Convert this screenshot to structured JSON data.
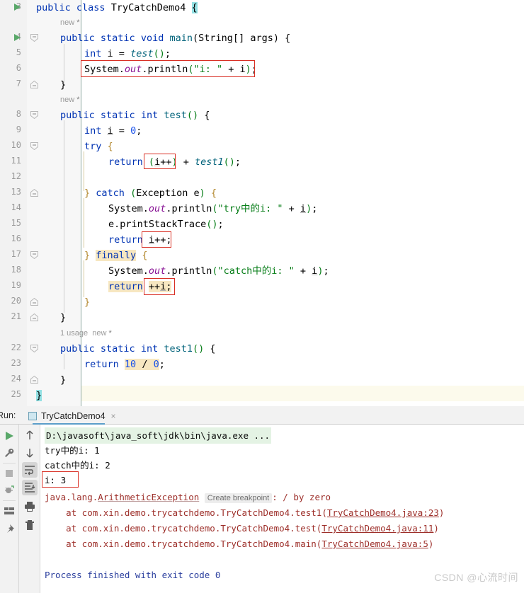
{
  "window": {
    "file_name": "TryCatchDemo4.java",
    "class_name": "TryCatchDemo4"
  },
  "editor": {
    "first_visible_line": 3,
    "lines": [
      {
        "n": "3",
        "text": "public class TryCatchDemo4 {"
      },
      {
        "n": "",
        "text": "new *"
      },
      {
        "n": "4",
        "text": "    public static void main(String[] args) {"
      },
      {
        "n": "5",
        "text": "        int i = test();"
      },
      {
        "n": "6",
        "text": "        System.out.println(\"i: \" + i);"
      },
      {
        "n": "7",
        "text": "    }"
      },
      {
        "n": "",
        "text": "new *"
      },
      {
        "n": "8",
        "text": "    public static int test() {"
      },
      {
        "n": "9",
        "text": "        int i = 0;"
      },
      {
        "n": "10",
        "text": "        try {"
      },
      {
        "n": "11",
        "text": "            return (i++) + test1();"
      },
      {
        "n": "12",
        "text": ""
      },
      {
        "n": "13",
        "text": "        } catch (Exception e) {"
      },
      {
        "n": "14",
        "text": "            System.out.println(\"try中的i: \" + i);"
      },
      {
        "n": "15",
        "text": "            e.printStackTrace();"
      },
      {
        "n": "16",
        "text": "            return i++;"
      },
      {
        "n": "17",
        "text": "        } finally {"
      },
      {
        "n": "18",
        "text": "            System.out.println(\"catch中的i: \" + i);"
      },
      {
        "n": "19",
        "text": "            return ++i;"
      },
      {
        "n": "20",
        "text": "        }"
      },
      {
        "n": "21",
        "text": "    }"
      },
      {
        "n": "",
        "text": "1 usage  new *"
      },
      {
        "n": "22",
        "text": "    public static int test1() {"
      },
      {
        "n": "23",
        "text": "        return 10 / 0;"
      },
      {
        "n": "24",
        "text": "    }"
      },
      {
        "n": "25",
        "text": "}"
      }
    ],
    "annotations": {
      "new_marker": "new",
      "new_star": "*",
      "usage_count": "1 usage"
    },
    "tokens": {
      "l3_public": "public",
      "l3_class": "class",
      "l3_name": "TryCatchDemo4",
      "l3_brace": "{",
      "l4": "public static void main(String[] args) {",
      "l4_public": "public",
      "l4_static": "static",
      "l4_void": "void",
      "l4_main": "main",
      "l4_string": "String",
      "l4_args": "args",
      "l5_int": "int",
      "l5_i": "i",
      "l5_test": "test",
      "l6_system": "System",
      "l6_out": "out",
      "l6_println": "println",
      "l6_str": "\"i: \"",
      "l6_i": "i",
      "l8_test": "test",
      "l8_int": "int",
      "l9_zero": "0",
      "l10_try": "try",
      "l11_return": "return",
      "l11_expr": "(i++)",
      "l11_test1": "test1",
      "l13_catch": "catch",
      "l13_exception": "Exception",
      "l13_e": "e",
      "l14_str": "\"try中的i: \"",
      "l15_e": "e",
      "l15_pst": "printStackTrace",
      "l16_return": "return",
      "l16_expr": "i++;",
      "l17_finally": "finally",
      "l18_str": "\"catch中的i: \"",
      "l19_return": "return",
      "l19_expr": "++i;",
      "l22_test1": "test1",
      "l23_return": "return",
      "l23_ten": "10",
      "l23_slash": "/",
      "l23_zero": "0"
    }
  },
  "run_panel": {
    "label": "Run:",
    "tab_name": "TryCatchDemo4",
    "close_glyph": "×",
    "toolbar_left": [
      {
        "name": "rerun-icon",
        "glyph": "play"
      },
      {
        "name": "wrench-icon",
        "glyph": "wrench"
      },
      {
        "name": "stop-icon",
        "glyph": "stop"
      },
      {
        "name": "debug-rerun-icon",
        "glyph": "bug-restart"
      },
      {
        "name": "layout-icon",
        "glyph": "layout"
      },
      {
        "name": "pin-icon",
        "glyph": "pin"
      }
    ],
    "toolbar_right": [
      {
        "name": "up-arrow-icon",
        "glyph": "↑"
      },
      {
        "name": "down-arrow-icon",
        "glyph": "↓"
      },
      {
        "name": "soft-wrap-icon",
        "glyph": "wrap"
      },
      {
        "name": "scroll-to-end-icon",
        "glyph": "scroll-end"
      },
      {
        "name": "print-icon",
        "glyph": "printer"
      },
      {
        "name": "clear-all-icon",
        "glyph": "trash"
      }
    ],
    "console": {
      "command_line": "D:\\javasoft\\java_soft\\jdk\\bin\\java.exe ...",
      "out_try": "try中的i: 1",
      "out_catch": "catch中的i: 2",
      "out_i": "i: 3",
      "exception_prefix": "java.lang.",
      "exception_type": "ArithmeticException",
      "create_breakpoint": "Create breakpoint",
      "exception_message": ": / by zero",
      "stack": [
        {
          "at": "    at com.xin.demo.trycatchdemo.TryCatchDemo4.test1(",
          "link": "TryCatchDemo4.java:23",
          "close": ")"
        },
        {
          "at": "    at com.xin.demo.trycatchdemo.TryCatchDemo4.test(",
          "link": "TryCatchDemo4.java:11",
          "close": ")"
        },
        {
          "at": "    at com.xin.demo.trycatchdemo.TryCatchDemo4.main(",
          "link": "TryCatchDemo4.java:5",
          "close": ")"
        }
      ],
      "process_finished": "Process finished with exit code 0"
    }
  },
  "watermark": "CSDN @心流时间",
  "colors": {
    "keyword": "#0033b3",
    "string": "#067d17",
    "number": "#1750eb",
    "field": "#871094",
    "method": "#00627a",
    "error": "#9d2f2a",
    "highlight_tan": "#f7e7c1",
    "highlight_brace": "#93e0e3",
    "red_box": "#d93025",
    "command_bg": "#e4f3e4"
  }
}
